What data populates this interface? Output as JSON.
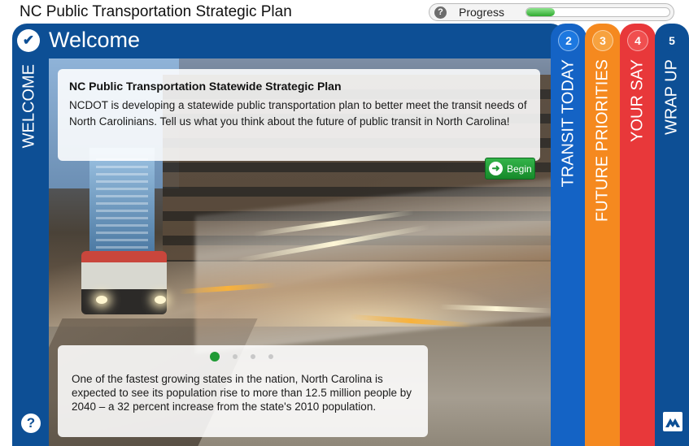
{
  "app": {
    "title": "NC Public Transportation Strategic Plan"
  },
  "progress": {
    "help_glyph": "?",
    "label": "Progress",
    "fraction": 0.2
  },
  "welcome": {
    "title": "Welcome",
    "side_label": "WELCOME",
    "help_glyph": "?"
  },
  "intro_card": {
    "title": "NC Public Transportation Statewide Strategic Plan",
    "body": "NCDOT is developing a statewide public transportation plan to better meet the transit needs of North Carolinians. Tell us what you think about the future of public transit in North Carolina!",
    "begin_label": "Begin"
  },
  "carousel": {
    "slide_count": 4,
    "active_index": 0
  },
  "fact_card": {
    "text": "One of the fastest growing states in the nation, North Carolina is expected to see its population rise to more than 12.5 million people by 2040 – a 32 percent increase from the state's 2010 population."
  },
  "tabs": [
    {
      "number": "2",
      "label": "TRANSIT TODAY",
      "color": "#1463c5"
    },
    {
      "number": "3",
      "label": "FUTURE PRIORITIES",
      "color": "#f5891f"
    },
    {
      "number": "4",
      "label": "YOUR SAY",
      "color": "#e8383a"
    },
    {
      "number": "5",
      "label": "WRAP UP",
      "color": "#0d4f95"
    }
  ],
  "icons": {
    "check": "check-icon",
    "help": "question-icon",
    "begin": "arrow-right-icon",
    "logo": "brand-logo-icon"
  },
  "colors": {
    "frame_blue": "#0d4f95",
    "progress_green": "#2faa2f",
    "begin_green": "#1f9a35"
  }
}
